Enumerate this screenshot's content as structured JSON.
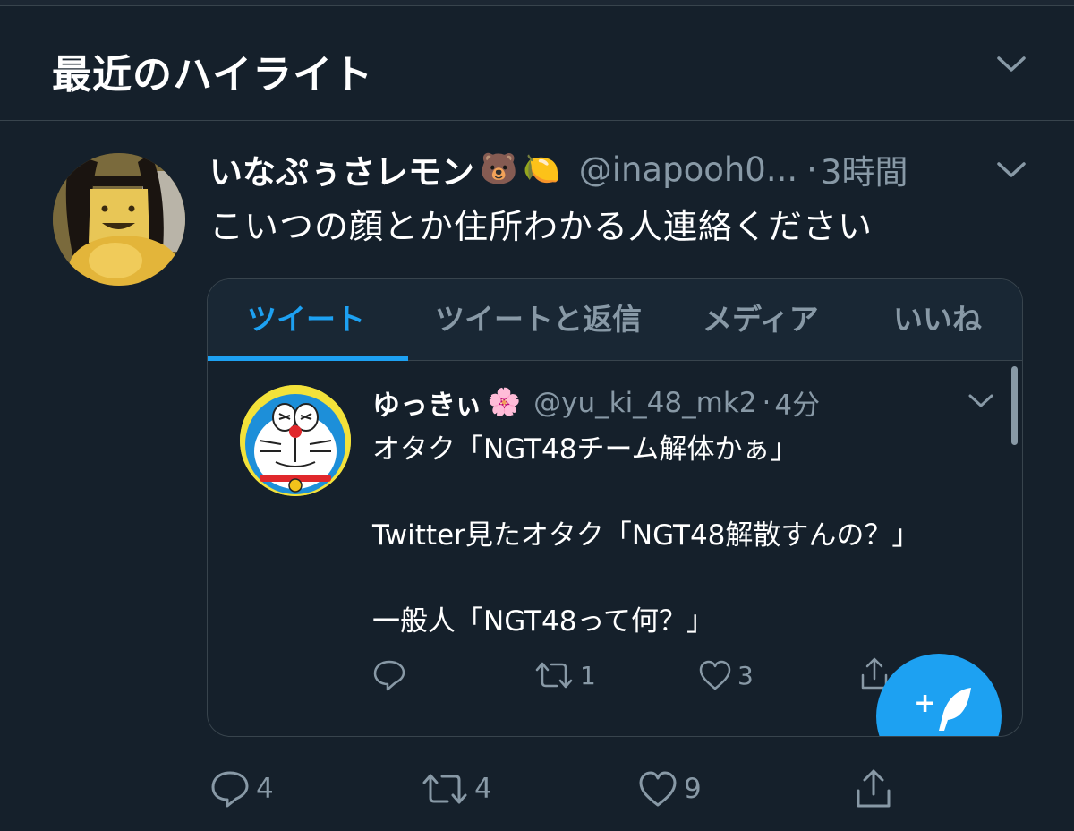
{
  "header": {
    "title": "最近のハイライト",
    "icon": "chevron-down-icon"
  },
  "tweet": {
    "display_name": "いなぷぅさレモン",
    "emojis": [
      "🐻",
      "🍋"
    ],
    "handle": "@inapooh0...",
    "separator": "·",
    "time": "3時間",
    "text": "こいつの顔とか住所わかる人連絡ください",
    "actions": {
      "reply_count": "4",
      "retweet_count": "4",
      "like_count": "9"
    }
  },
  "embed": {
    "tabs": [
      {
        "label": "ツイート",
        "active": true
      },
      {
        "label": "ツイートと返信",
        "active": false
      },
      {
        "label": "メディア",
        "active": false
      },
      {
        "label": "いいね",
        "active": false
      }
    ],
    "tweet": {
      "display_name": "ゆっきぃ",
      "emoji": "🌸",
      "handle": "@yu_ki_48_mk2",
      "separator": "·",
      "time": "4分",
      "lines": [
        "オタク「NGT48チーム解体かぁ」",
        "Twitter見たオタク「NGT48解散すんの？」",
        "一般人「NGT48って何？」"
      ],
      "actions": {
        "retweet_count": "1",
        "like_count": "3"
      }
    }
  },
  "colors": {
    "background": "#15202b",
    "accent": "#1da1f2",
    "muted": "#8899a6",
    "border": "#38444d"
  }
}
